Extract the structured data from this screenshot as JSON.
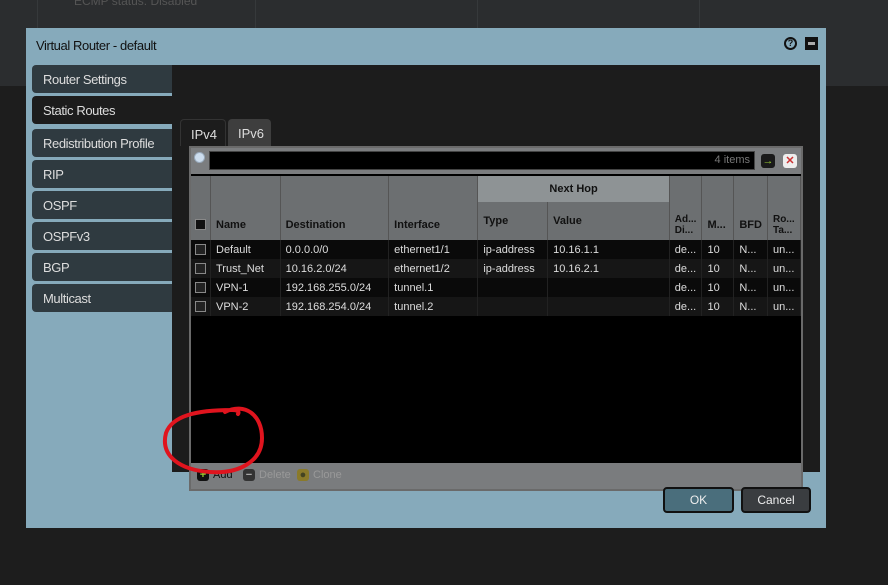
{
  "background": {
    "status_text": "ECMP status: Disabled"
  },
  "dialog": {
    "title": "Virtual Router - default",
    "help_icon": "help-icon",
    "maximize_icon": "maximize-icon"
  },
  "sidebar": {
    "items": [
      {
        "label": "Router Settings"
      },
      {
        "label": "Static Routes",
        "active": true
      },
      {
        "label": "Redistribution Profile"
      },
      {
        "label": "RIP"
      },
      {
        "label": "OSPF"
      },
      {
        "label": "OSPFv3"
      },
      {
        "label": "BGP"
      },
      {
        "label": "Multicast"
      }
    ]
  },
  "tabs": [
    {
      "label": "IPv4",
      "active": true
    },
    {
      "label": "IPv6"
    }
  ],
  "grid": {
    "search": {
      "value": "",
      "items_count": "4 items",
      "apply_icon": "arrow-right-icon",
      "clear_icon": "close-icon"
    },
    "group_header": "Next Hop",
    "columns": [
      "Name",
      "Destination",
      "Interface",
      "Type",
      "Value",
      "Ad... Di...",
      "M...",
      "BFD",
      "Ro... Ta..."
    ],
    "rows": [
      [
        "Default",
        "0.0.0.0/0",
        "ethernet1/1",
        "ip-address",
        "10.16.1.1",
        "de...",
        "10",
        "N...",
        "un..."
      ],
      [
        "Trust_Net",
        "10.16.2.0/24",
        "ethernet1/2",
        "ip-address",
        "10.16.2.1",
        "de...",
        "10",
        "N...",
        "un..."
      ],
      [
        "VPN-1",
        "192.168.255.0/24",
        "tunnel.1",
        "",
        "",
        "de...",
        "10",
        "N...",
        "un..."
      ],
      [
        "VPN-2",
        "192.168.254.0/24",
        "tunnel.2",
        "",
        "",
        "de...",
        "10",
        "N...",
        "un..."
      ]
    ],
    "footer": {
      "add": "Add",
      "delete": "Delete",
      "clone": "Clone"
    }
  },
  "buttons": {
    "ok": "OK",
    "cancel": "Cancel"
  },
  "colors": {
    "dialog_bg": "#86aabb",
    "annotation": "#e0141e",
    "add_icon": "#9acd32"
  }
}
